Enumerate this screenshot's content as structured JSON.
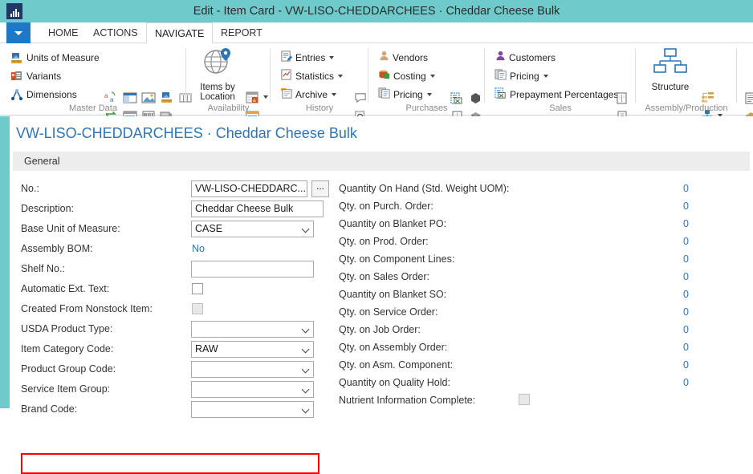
{
  "window": {
    "title": "Edit - Item Card - VW-LISO-CHEDDARCHEES · Cheddar Cheese Bulk",
    "logo_icon": "chart-bars-icon"
  },
  "tabs": {
    "app_menu_icon": "chevron-down-icon",
    "items": [
      {
        "label": "HOME",
        "active": false
      },
      {
        "label": "ACTIONS",
        "active": false
      },
      {
        "label": "NAVIGATE",
        "active": true
      },
      {
        "label": "REPORT",
        "active": false
      }
    ]
  },
  "ribbon": {
    "groups": [
      {
        "name": "Master Data",
        "label": "Master Data",
        "items": [
          {
            "label": "Units of Measure",
            "icon": "units-of-measure-icon"
          },
          {
            "label": "Variants",
            "icon": "variants-icon"
          },
          {
            "label": "Dimensions",
            "icon": "dimensions-icon"
          }
        ],
        "icon_only": [
          "translations-icon",
          "extended-texts-icon",
          "picture-icon",
          "item-attributes-icon",
          "item-tracking-icon",
          "substitutions-icon",
          "item-references-icon",
          "bar-codes-icon",
          "catalog-icon",
          "item-journal-icon",
          "text-attributes-icon",
          "resources-icon",
          "approvals-icon"
        ]
      },
      {
        "name": "Availability",
        "label": "Availability",
        "items": [
          {
            "label": "Items by Location",
            "icon": "globe-location-icon"
          }
        ],
        "icon_only": [
          "calendar-availability-icon",
          "period-availability-icon",
          "bom-level-icon"
        ]
      },
      {
        "name": "History",
        "label": "History",
        "items": [
          {
            "label": "Entries",
            "icon": "entries-icon",
            "dropdown": true
          },
          {
            "label": "Statistics",
            "icon": "statistics-icon",
            "dropdown": true
          },
          {
            "label": "Archive",
            "icon": "archive-icon",
            "dropdown": true
          }
        ],
        "icon_only": [
          "comments-icon",
          "document-search-icon"
        ]
      },
      {
        "name": "Purchases",
        "label": "Purchases",
        "items": [
          {
            "label": "Vendors",
            "icon": "vendor-person-icon"
          },
          {
            "label": "Costing",
            "icon": "costing-icon",
            "dropdown": true
          },
          {
            "label": "Pricing",
            "icon": "pricing-icon",
            "dropdown": true
          }
        ],
        "icon_only": [
          "export-excel-icon",
          "hexagon-icon",
          "document-pages-icon",
          "box-3d-icon",
          "import-document-icon",
          "color-tiles-icon"
        ]
      },
      {
        "name": "Sales",
        "label": "Sales",
        "items": [
          {
            "label": "Customers",
            "icon": "customer-person-icon"
          },
          {
            "label": "Pricing",
            "icon": "pricing-icon",
            "dropdown": true
          },
          {
            "label": "Prepayment Percentages",
            "icon": "prepayment-icon"
          }
        ],
        "icon_only": [
          "document-lines-icon",
          "import-document-icon",
          "document-search-icon"
        ]
      },
      {
        "name": "Assembly/Production",
        "label": "Assembly/Production",
        "items": [
          {
            "label": "Structure",
            "icon": "structure-tree-icon"
          }
        ],
        "icon_only": [
          "where-used-icon",
          "assembly-bom-icon",
          "production-bom-icon"
        ]
      },
      {
        "name": "Overflow",
        "label": "",
        "items": [],
        "icon_only": [
          "planning-list-icon",
          "warehouse-icon",
          "shipping-icon"
        ]
      }
    ]
  },
  "page": {
    "record_no": "VW-LISO-CHEDDARCHEES",
    "record_separator": "·",
    "record_description": "Cheddar Cheese Bulk",
    "fasttab_general": "General"
  },
  "left_fields": [
    {
      "label": "No.:",
      "type": "text",
      "value": "VW-LISO-CHEDDARC...",
      "assist": "..."
    },
    {
      "label": "Description:",
      "type": "text",
      "value": "Cheddar Cheese Bulk"
    },
    {
      "label": "Base Unit of Measure:",
      "type": "combo",
      "value": "CASE"
    },
    {
      "label": "Assembly BOM:",
      "type": "link",
      "value": "No"
    },
    {
      "label": "Shelf No.:",
      "type": "text",
      "value": ""
    },
    {
      "label": "Automatic Ext. Text:",
      "type": "check",
      "value": "",
      "checked": false,
      "disabled": false
    },
    {
      "label": "Created From Nonstock Item:",
      "type": "check",
      "value": "",
      "checked": false,
      "disabled": true
    },
    {
      "label": "USDA Product Type:",
      "type": "combo",
      "value": ""
    },
    {
      "label": "Item Category Code:",
      "type": "combo",
      "value": "RAW",
      "highlighted": true
    },
    {
      "label": "Product Group Code:",
      "type": "combo",
      "value": ""
    },
    {
      "label": "Service Item Group:",
      "type": "combo",
      "value": ""
    },
    {
      "label": "Brand Code:",
      "type": "combo",
      "value": ""
    }
  ],
  "right_fields": [
    {
      "label": "Quantity On Hand (Std. Weight UOM):",
      "type": "number",
      "value": "0"
    },
    {
      "label": "Qty. on Purch. Order:",
      "type": "number",
      "value": "0"
    },
    {
      "label": "Quantity on Blanket PO:",
      "type": "number",
      "value": "0"
    },
    {
      "label": "Qty. on Prod. Order:",
      "type": "number",
      "value": "0"
    },
    {
      "label": "Qty. on Component Lines:",
      "type": "number",
      "value": "0"
    },
    {
      "label": "Qty. on Sales Order:",
      "type": "number",
      "value": "0"
    },
    {
      "label": "Quantity on Blanket SO:",
      "type": "number",
      "value": "0"
    },
    {
      "label": "Qty. on Service Order:",
      "type": "number",
      "value": "0"
    },
    {
      "label": "Qty. on Job Order:",
      "type": "number",
      "value": "0"
    },
    {
      "label": "Qty. on Assembly Order:",
      "type": "number",
      "value": "0"
    },
    {
      "label": "Qty. on Asm. Component:",
      "type": "number",
      "value": "0"
    },
    {
      "label": "Quantity on Quality Hold:",
      "type": "number",
      "value": "0"
    },
    {
      "label": "Nutrient Information Complete:",
      "type": "check",
      "value": "",
      "checked": false,
      "disabled": true
    }
  ],
  "colors": {
    "titlebar": "#6FCBCB",
    "accent_blue": "#1E78C8",
    "link_blue": "#2E75B6",
    "highlight_red": "#FF0000",
    "fasttab_gray": "#EDEDED"
  }
}
